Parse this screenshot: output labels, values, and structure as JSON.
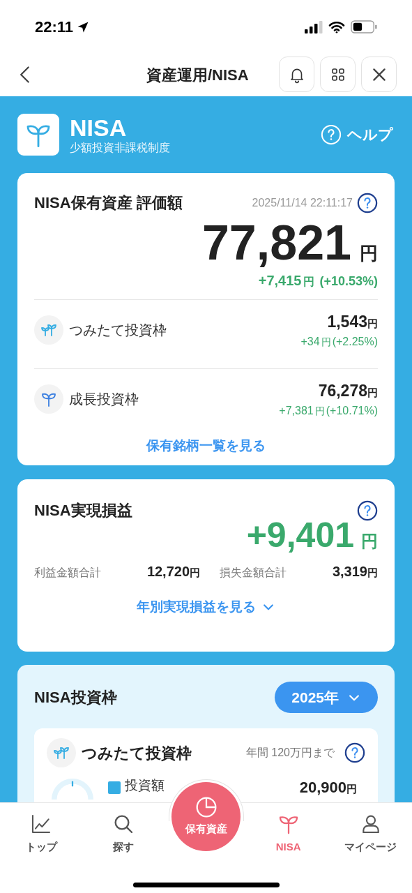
{
  "status_bar": {
    "time": "22:11"
  },
  "header": {
    "title": "資産運用/NISA"
  },
  "hero": {
    "title": "NISA",
    "subtitle": "少額投資非課税制度",
    "help": "ヘルプ"
  },
  "holdings": {
    "title": "NISA保有資産 評価額",
    "timestamp": "2025/11/14 22:11:17",
    "value": "77,821",
    "unit": "円",
    "change": "+7,415",
    "change_unit": "円",
    "change_pct": "(+10.53%)",
    "rows": [
      {
        "kind": "tsumitate",
        "label": "つみたて投資枠",
        "value": "1,543",
        "unit": "円",
        "change": "+34",
        "change_unit": "円",
        "change_pct": "(+2.25%)"
      },
      {
        "kind": "growth",
        "label": "成長投資枠",
        "value": "76,278",
        "unit": "円",
        "change": "+7,381",
        "change_unit": "円",
        "change_pct": "(+10.71%)"
      }
    ],
    "link": "保有銘柄一覧を見る"
  },
  "realized": {
    "title": "NISA実現損益",
    "value": "+9,401",
    "unit": "円",
    "profit_label": "利益金額合計",
    "profit": "12,720",
    "profit_unit": "円",
    "loss_label": "損失金額合計",
    "loss": "3,319",
    "loss_unit": "円",
    "link": "年別実現損益を見る"
  },
  "quota": {
    "title": "NISA投資枠",
    "year": "2025年",
    "card": {
      "title": "つみたて投資枠",
      "limit": "年間 120万円まで",
      "legend": "投資額",
      "amount": "20,900",
      "unit": "円"
    }
  },
  "tab_bar": {
    "items": [
      {
        "kind": "chart",
        "label": "トップ",
        "selected": false
      },
      {
        "kind": "search",
        "label": "探す",
        "selected": false
      },
      {
        "kind": "center",
        "label": "保有資産",
        "selected": false
      },
      {
        "kind": "sprout",
        "label": "NISA",
        "selected": true
      },
      {
        "kind": "person",
        "label": "マイページ",
        "selected": false
      }
    ]
  }
}
